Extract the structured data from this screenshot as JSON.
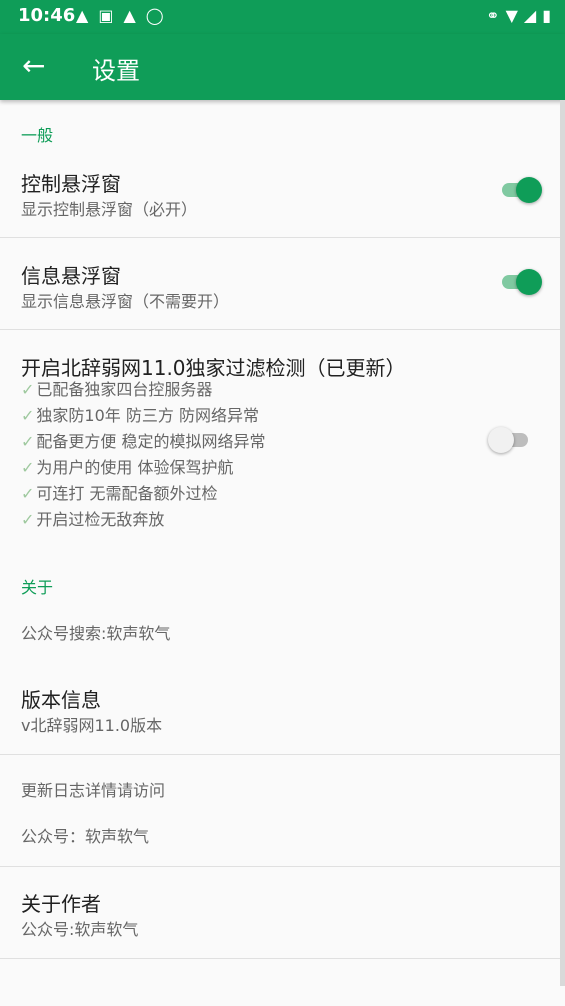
{
  "status_bar": {
    "time": "10:46",
    "icons_left": [
      "android-icon",
      "a-box-icon",
      "android-icon",
      "shield-icon"
    ],
    "icons_right": [
      "key-icon",
      "wifi-icon",
      "signal-icon",
      "battery-icon"
    ]
  },
  "app_bar": {
    "title": "设置"
  },
  "sections": {
    "general": {
      "label": "一般",
      "items": [
        {
          "title": "控制悬浮窗",
          "summary": "显示控制悬浮窗（必开）",
          "switch_on": true
        },
        {
          "title": "信息悬浮窗",
          "summary": "显示信息悬浮窗（不需要开）",
          "switch_on": true
        }
      ],
      "filter": {
        "title": "开启北辞弱网11.0独家过滤检测（已更新）",
        "lines": [
          "已配备独家四台控服务器",
          "独家防10年 防三方 防网络异常",
          "配备更方便 稳定的模拟网络异常",
          "为用户的使用 体验保驾护航",
          "可连打 无需配备额外过检",
          "开启过检无敌奔放"
        ],
        "check_mark": "✓",
        "switch_on": false
      }
    },
    "about": {
      "label": "关于",
      "search": "公众号搜索:软声软气",
      "version_title": "版本信息",
      "version_value": "v北辞弱网11.0版本",
      "changelog": "更新日志详情请访问",
      "official": "公众号：软声软气",
      "author_title": "关于作者",
      "author_value": "公众号:软声软气"
    }
  }
}
